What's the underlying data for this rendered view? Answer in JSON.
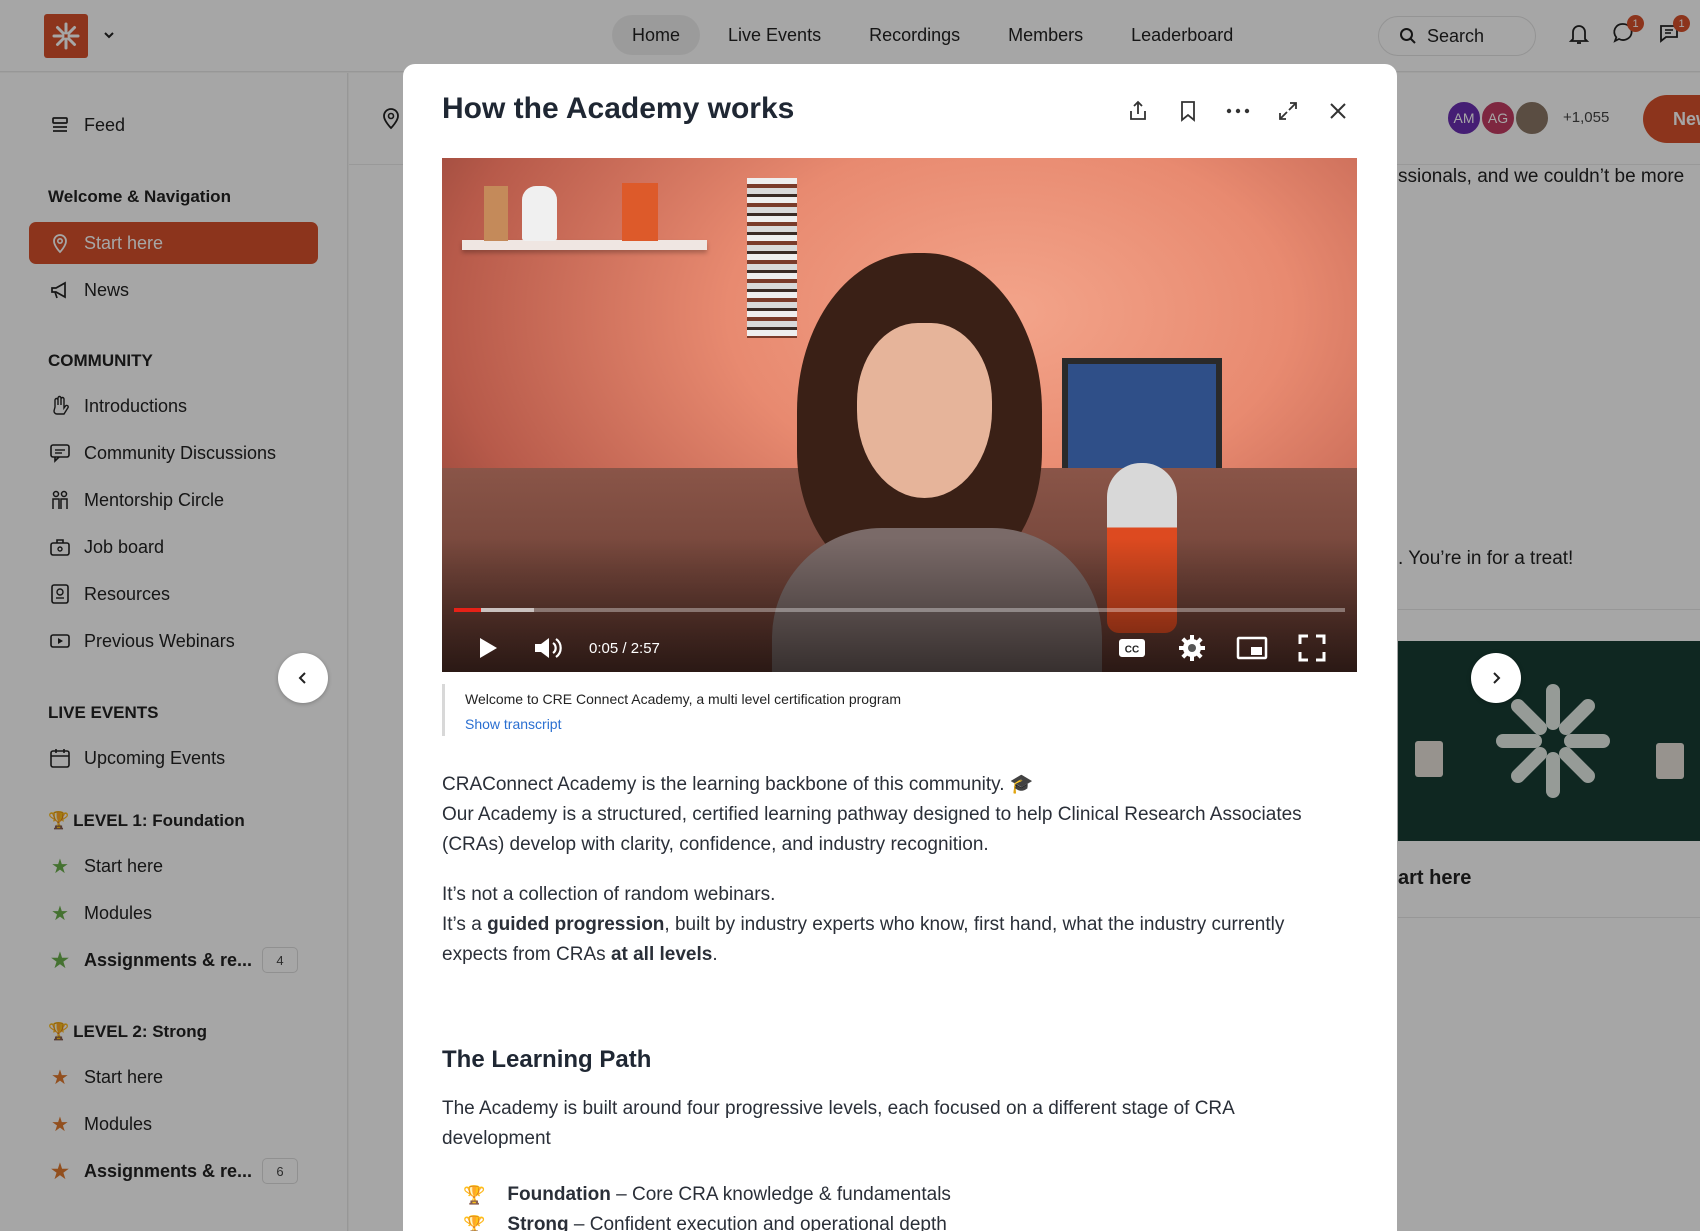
{
  "topnav": {
    "tabs": [
      "Home",
      "Live Events",
      "Recordings",
      "Members",
      "Leaderboard"
    ],
    "active": "Home"
  },
  "search": {
    "label": "Search"
  },
  "notifications": {
    "messages_badge": "1",
    "chat_badge": "1"
  },
  "sidebar": {
    "feed": "Feed",
    "sections": [
      {
        "title": "Welcome & Navigation",
        "items": [
          "Start here",
          "News"
        ]
      },
      {
        "title": "COMMUNITY",
        "items": [
          "Introductions",
          "Community Discussions",
          "Mentorship Circle",
          "Job board",
          "Resources",
          "Previous Webinars"
        ]
      },
      {
        "title": "LIVE EVENTS",
        "items": [
          "Upcoming Events"
        ]
      },
      {
        "title": "LEVEL 1: Foundation",
        "items": [
          "Start here",
          "Modules",
          "Assignments & re..."
        ],
        "count": "4"
      },
      {
        "title": "LEVEL 2: Strong",
        "items": [
          "Start here",
          "Modules",
          "Assignments & re..."
        ],
        "count": "6"
      }
    ]
  },
  "header": {
    "avatars": [
      "AM",
      "AG"
    ],
    "members_more": "+1,055",
    "new_button": "New"
  },
  "background": {
    "text_1": "ssionals, and we couldn’t be more",
    "text_2": ". You’re in for a treat!",
    "card_title": "art here"
  },
  "modal": {
    "title": "How the Academy works",
    "video": {
      "time": "0:05 / 2:57",
      "progress": 0.03,
      "buffered": 0.09
    },
    "caption": "Welcome to CRE Connect Academy, a multi level certification program",
    "show_transcript": "Show transcript",
    "p1_line1": "CRAConnect Academy is the learning backbone of this community. 🎓",
    "p1_line2": "Our Academy is a structured, certified learning pathway designed to help Clinical Research Associates (CRAs) develop with clarity, confidence, and industry recognition.",
    "p2_line1": "It’s not a collection of random webinars.",
    "p2_pre": "It’s a ",
    "p2_bold1": "guided progression",
    "p2_mid": ", built by industry experts who know, first hand, what the industry currently expects from CRAs ",
    "p2_bold2": "at all levels",
    "p2_end": ".",
    "section_title": "The Learning Path",
    "section_text": "The Academy is built around four progressive levels, each focused on a different stage of CRA development",
    "levels": [
      {
        "name": "Foundation",
        "desc": " – Core CRA knowledge & fundamentals"
      },
      {
        "name": "Strong",
        "desc": " – Confident execution and operational depth"
      }
    ]
  },
  "colors": {
    "brand": "#d8512b",
    "star_green": "#6ab04c",
    "star_orange": "#e07a2f"
  }
}
